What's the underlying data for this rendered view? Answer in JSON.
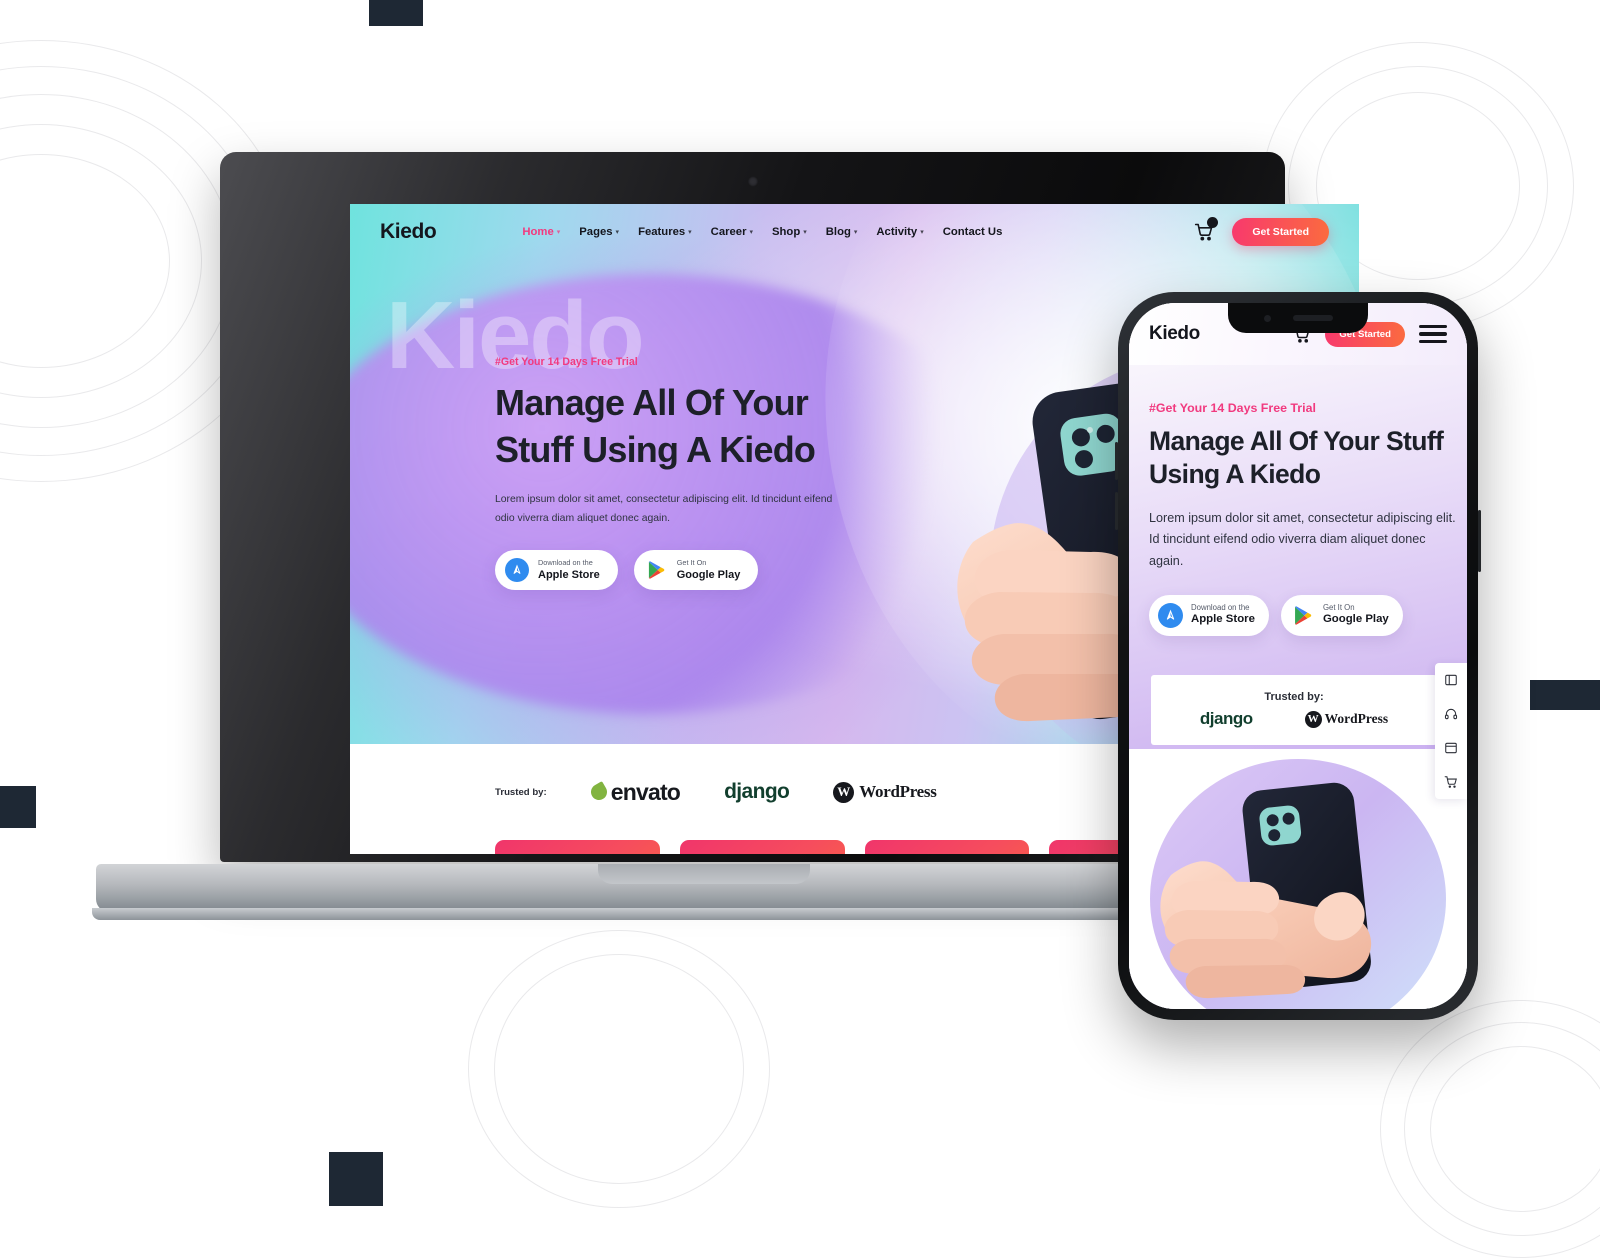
{
  "brand": "Kiedo",
  "desktop": {
    "nav": {
      "logo": "Kiedo",
      "items": [
        {
          "label": "Home",
          "active": true,
          "caret": true
        },
        {
          "label": "Pages",
          "active": false,
          "caret": true
        },
        {
          "label": "Features",
          "active": false,
          "caret": true
        },
        {
          "label": "Career",
          "active": false,
          "caret": true
        },
        {
          "label": "Shop",
          "active": false,
          "caret": true
        },
        {
          "label": "Blog",
          "active": false,
          "caret": true
        },
        {
          "label": "Activity",
          "active": false,
          "caret": true
        },
        {
          "label": "Contact Us",
          "active": false,
          "caret": false
        }
      ],
      "cart_icon": "shopping-cart-icon",
      "cta_label": "Get Started"
    },
    "hero": {
      "watermark": "Kiedo",
      "tagline": "#Get Your 14 Days Free Trial",
      "heading_line1": "Manage All Of Your",
      "heading_line2": "Stuff Using A Kiedo",
      "paragraph": "Lorem ipsum dolor sit amet, consectetur adipiscing elit. Id tincidunt eifend odio viverra diam aliquet donec again.",
      "stores": [
        {
          "small": "Download on the",
          "big": "Apple Store",
          "icon": "apple-store-icon"
        },
        {
          "small": "Get It On",
          "big": "Google Play",
          "icon": "google-play-icon"
        }
      ]
    },
    "trusted": {
      "label": "Trusted by:",
      "logos": [
        "envato",
        "django",
        "WordPress"
      ]
    },
    "feature_cards": [
      {
        "icon": "document-icon"
      },
      {
        "icon": "target-icon"
      },
      {
        "icon": "spiral-icon"
      },
      {
        "icon": "shield-icon"
      }
    ]
  },
  "mobile": {
    "nav": {
      "logo": "Kiedo",
      "cart_icon": "shopping-cart-icon",
      "cta_label": "Get Started",
      "menu_icon": "hamburger-menu-icon"
    },
    "hero": {
      "tagline": "#Get Your 14 Days Free Trial",
      "heading_line1": "Manage All Of Your Stuff",
      "heading_line2": "Using A Kiedo",
      "paragraph": "Lorem ipsum dolor sit amet, consectetur adipiscing elit. Id tincidunt eifend odio viverra diam aliquet donec again.",
      "stores": [
        {
          "small": "Download on the",
          "big": "Apple Store",
          "icon": "apple-store-icon"
        },
        {
          "small": "Get It On",
          "big": "Google Play",
          "icon": "google-play-icon"
        }
      ]
    },
    "trusted": {
      "label": "Trusted by:",
      "logos": [
        "django",
        "WordPress"
      ]
    },
    "toolbar": [
      {
        "icon": "layout-panel-icon"
      },
      {
        "icon": "headphones-icon"
      },
      {
        "icon": "book-icon"
      },
      {
        "icon": "cart-icon"
      }
    ]
  },
  "colors": {
    "accent_pink": "#f13a7f",
    "cta_gradient_start": "#f8396d",
    "cta_gradient_end": "#fb6b3f",
    "heading": "#1d2029",
    "hero_cyan": "#55ded6",
    "hero_purple": "#c9aef0",
    "card_gradient_start": "#f0356b",
    "card_gradient_end": "#fb7033",
    "square_decor": "#1e2834"
  }
}
